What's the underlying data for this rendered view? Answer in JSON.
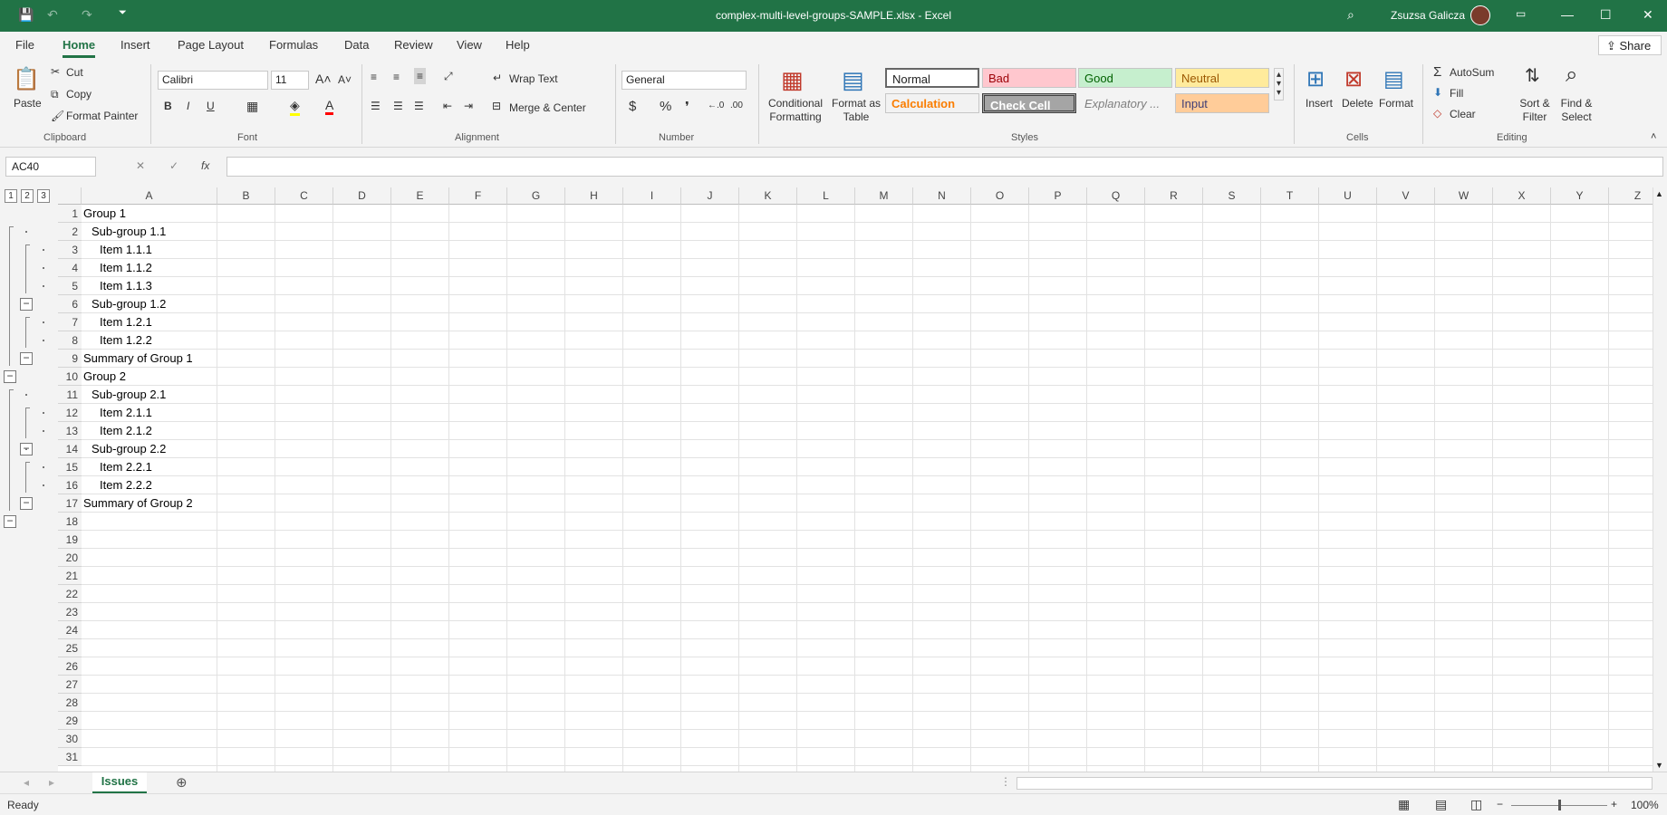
{
  "window": {
    "title": "complex-multi-level-groups-SAMPLE.xlsx  -  Excel",
    "user": "Zsuzsa Galicza"
  },
  "menu": {
    "tabs": [
      "File",
      "Home",
      "Insert",
      "Page Layout",
      "Formulas",
      "Data",
      "Review",
      "View",
      "Help"
    ],
    "active": "Home",
    "share": "Share"
  },
  "ribbon": {
    "clipboard": {
      "paste": "Paste",
      "cut": "Cut",
      "copy": "Copy",
      "format_painter": "Format Painter",
      "label": "Clipboard"
    },
    "font": {
      "family": "Calibri",
      "size": "11",
      "bold": "B",
      "italic": "I",
      "underline": "U",
      "label": "Font"
    },
    "alignment": {
      "wrap": "Wrap Text",
      "merge": "Merge & Center",
      "label": "Alignment"
    },
    "number": {
      "format": "General",
      "currency": "$",
      "percent": "%",
      "comma": "❜",
      "label": "Number"
    },
    "styles": {
      "conditional": "Conditional Formatting",
      "format_table": "Format as Table",
      "normal": "Normal",
      "bad": "Bad",
      "good": "Good",
      "neutral": "Neutral",
      "calculation": "Calculation",
      "check_cell": "Check Cell",
      "explanatory": "Explanatory ...",
      "input": "Input",
      "label": "Styles"
    },
    "cells": {
      "insert": "Insert",
      "delete": "Delete",
      "format": "Format",
      "label": "Cells"
    },
    "editing": {
      "autosum": "AutoSum",
      "fill": "Fill",
      "clear": "Clear",
      "sort": "Sort & Filter",
      "find": "Find & Select",
      "label": "Editing"
    }
  },
  "formula_bar": {
    "name_box": "AC40",
    "fx": "fx",
    "value": ""
  },
  "outline_levels": [
    "1",
    "2",
    "3"
  ],
  "columns": [
    "A",
    "B",
    "C",
    "D",
    "E",
    "F",
    "G",
    "H",
    "I",
    "J",
    "K",
    "L",
    "M",
    "N",
    "O",
    "P",
    "Q",
    "R",
    "S",
    "T",
    "U",
    "V",
    "W",
    "X",
    "Y",
    "Z"
  ],
  "rows": [
    {
      "n": "1",
      "a": "Group 1",
      "indent": 0
    },
    {
      "n": "2",
      "a": "Sub-group 1.1",
      "indent": 1
    },
    {
      "n": "3",
      "a": "Item 1.1.1",
      "indent": 2
    },
    {
      "n": "4",
      "a": "Item 1.1.2",
      "indent": 2
    },
    {
      "n": "5",
      "a": "Item 1.1.3",
      "indent": 2
    },
    {
      "n": "6",
      "a": "Sub-group 1.2",
      "indent": 1
    },
    {
      "n": "7",
      "a": "Item 1.2.1",
      "indent": 2
    },
    {
      "n": "8",
      "a": "Item 1.2.2",
      "indent": 2
    },
    {
      "n": "9",
      "a": "Summary of Group 1",
      "indent": 0
    },
    {
      "n": "10",
      "a": "Group 2",
      "indent": 0
    },
    {
      "n": "11",
      "a": "Sub-group 2.1",
      "indent": 1
    },
    {
      "n": "12",
      "a": "Item 2.1.1",
      "indent": 2
    },
    {
      "n": "13",
      "a": "Item 2.1.2",
      "indent": 2
    },
    {
      "n": "14",
      "a": "Sub-group 2.2",
      "indent": 1
    },
    {
      "n": "15",
      "a": "Item 2.2.1",
      "indent": 2
    },
    {
      "n": "16",
      "a": "Item 2.2.2",
      "indent": 2
    },
    {
      "n": "17",
      "a": "Summary of Group 2",
      "indent": 0
    },
    {
      "n": "18",
      "a": "",
      "indent": 0
    },
    {
      "n": "19",
      "a": "",
      "indent": 0
    },
    {
      "n": "20",
      "a": "",
      "indent": 0
    },
    {
      "n": "21",
      "a": "",
      "indent": 0
    },
    {
      "n": "22",
      "a": "",
      "indent": 0
    },
    {
      "n": "23",
      "a": "",
      "indent": 0
    },
    {
      "n": "24",
      "a": "",
      "indent": 0
    },
    {
      "n": "25",
      "a": "",
      "indent": 0
    },
    {
      "n": "26",
      "a": "",
      "indent": 0
    },
    {
      "n": "27",
      "a": "",
      "indent": 0
    },
    {
      "n": "28",
      "a": "",
      "indent": 0
    },
    {
      "n": "29",
      "a": "",
      "indent": 0
    },
    {
      "n": "30",
      "a": "",
      "indent": 0
    },
    {
      "n": "31",
      "a": "",
      "indent": 0
    }
  ],
  "sheet": {
    "tab": "Issues"
  },
  "status": {
    "state": "Ready",
    "zoom": "100%"
  },
  "colors": {
    "accent": "#217346",
    "bad": "#ffc7ce",
    "good": "#c6efce",
    "neutral": "#ffeb9c",
    "calc": "#f2f2f2",
    "check": "#a5a5a5",
    "input": "#ffcc99"
  }
}
